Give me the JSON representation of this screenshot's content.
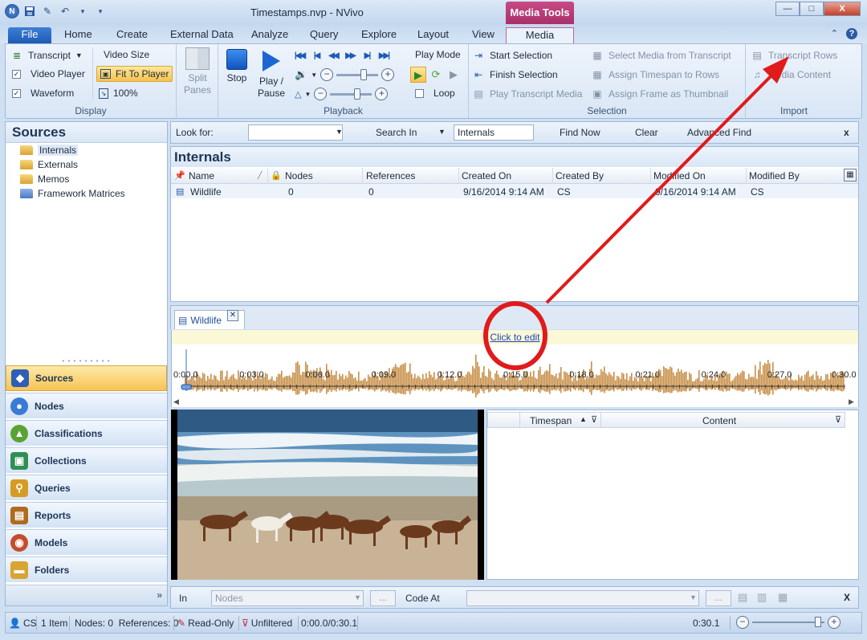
{
  "window": {
    "title": "Timestamps.nvp - NVivo",
    "context_tab_group": "Media Tools",
    "min_label": "—",
    "max_label": "□",
    "close_label": "X"
  },
  "ribbon_tabs": [
    "File",
    "Home",
    "Create",
    "External Data",
    "Analyze",
    "Query",
    "Explore",
    "Layout",
    "View",
    "Media"
  ],
  "active_tab": "Media",
  "ribbon": {
    "display": {
      "label": "Display",
      "transcript": "Transcript",
      "video_player": "Video Player",
      "waveform": "Waveform",
      "video_size": "Video Size",
      "fit_to_player": "Fit To Player",
      "zoom_100": "100%",
      "video_player_checked": true,
      "waveform_checked": true
    },
    "split_panes": {
      "line1": "Split",
      "line2": "Panes"
    },
    "playback": {
      "label": "Playback",
      "stop": "Stop",
      "play_line1": "Play /",
      "play_line2": "Pause",
      "play_mode": "Play Mode",
      "loop": "Loop",
      "loop_checked": false
    },
    "selection": {
      "label": "Selection",
      "start_selection": "Start Selection",
      "finish_selection": "Finish Selection",
      "play_transcript_media": "Play Transcript Media",
      "select_media_from_transcript": "Select Media from Transcript",
      "assign_timespan_to_rows": "Assign Timespan to Rows",
      "assign_frame_as_thumbnail": "Assign Frame as Thumbnail"
    },
    "import": {
      "label": "Import",
      "transcript_rows": "Transcript Rows",
      "media_content": "Media Content"
    }
  },
  "nav": {
    "title": "Sources",
    "tree": [
      "Internals",
      "Externals",
      "Memos",
      "Framework Matrices"
    ],
    "selected_tree_item": "Internals",
    "buttons": [
      {
        "label": "Sources",
        "icon": "sources-icon",
        "color": "#2d5fb8"
      },
      {
        "label": "Nodes",
        "icon": "nodes-icon",
        "color": "#3a7bd5"
      },
      {
        "label": "Classifications",
        "icon": "classifications-icon",
        "color": "#5aa332"
      },
      {
        "label": "Collections",
        "icon": "collections-icon",
        "color": "#2f8f55"
      },
      {
        "label": "Queries",
        "icon": "queries-icon",
        "color": "#d79b24"
      },
      {
        "label": "Reports",
        "icon": "reports-icon",
        "color": "#b06b20"
      },
      {
        "label": "Models",
        "icon": "models-icon",
        "color": "#c64c2c"
      },
      {
        "label": "Folders",
        "icon": "folders-icon",
        "color": "#d9a431"
      }
    ],
    "active_button": "Sources",
    "more": "»"
  },
  "findbar": {
    "look_for_label": "Look for:",
    "look_for_value": "",
    "search_in_label": "Search In",
    "search_in_value": "Internals",
    "find_now": "Find Now",
    "clear": "Clear",
    "advanced_find": "Advanced Find",
    "close": "x"
  },
  "list": {
    "title": "Internals",
    "columns": [
      "Name",
      "Nodes",
      "References",
      "Created On",
      "Created By",
      "Modified On",
      "Modified By"
    ],
    "rows": [
      {
        "name": "Wildlife",
        "nodes": "0",
        "references": "0",
        "created_on": "9/16/2014 9:14 AM",
        "created_by": "CS",
        "modified_on": "9/16/2014 9:14 AM",
        "modified_by": "CS"
      }
    ]
  },
  "detail": {
    "tab": "Wildlife",
    "click_to_edit": "Click to edit",
    "timeline": [
      "0:00.0",
      "0:03.0",
      "0:06.0",
      "0:09.0",
      "0:12.0",
      "0:15.0",
      "0:18.0",
      "0:21.0",
      "0:24.0",
      "0:27.0",
      "0:30.0"
    ],
    "transcript_columns": [
      "Timespan",
      "Content"
    ],
    "waveform_color": "#c8904a"
  },
  "codebar": {
    "in_label": "In",
    "in_placeholder": "Nodes",
    "code_at_label": "Code At",
    "dots": "...",
    "close": "X"
  },
  "status": {
    "user": "CS",
    "items": "1 Item",
    "nodes_refs": "Nodes: 0  References: 0",
    "read_only": "Read-Only",
    "unfiltered": "Unfiltered",
    "position": "0:00.0/0:30.1",
    "duration": "0:30.1"
  },
  "colors": {
    "accent": "#1e5bb5",
    "context_tab": "#a8306a",
    "annotation": "#e01b1b",
    "active_nav": "#f8c453"
  }
}
